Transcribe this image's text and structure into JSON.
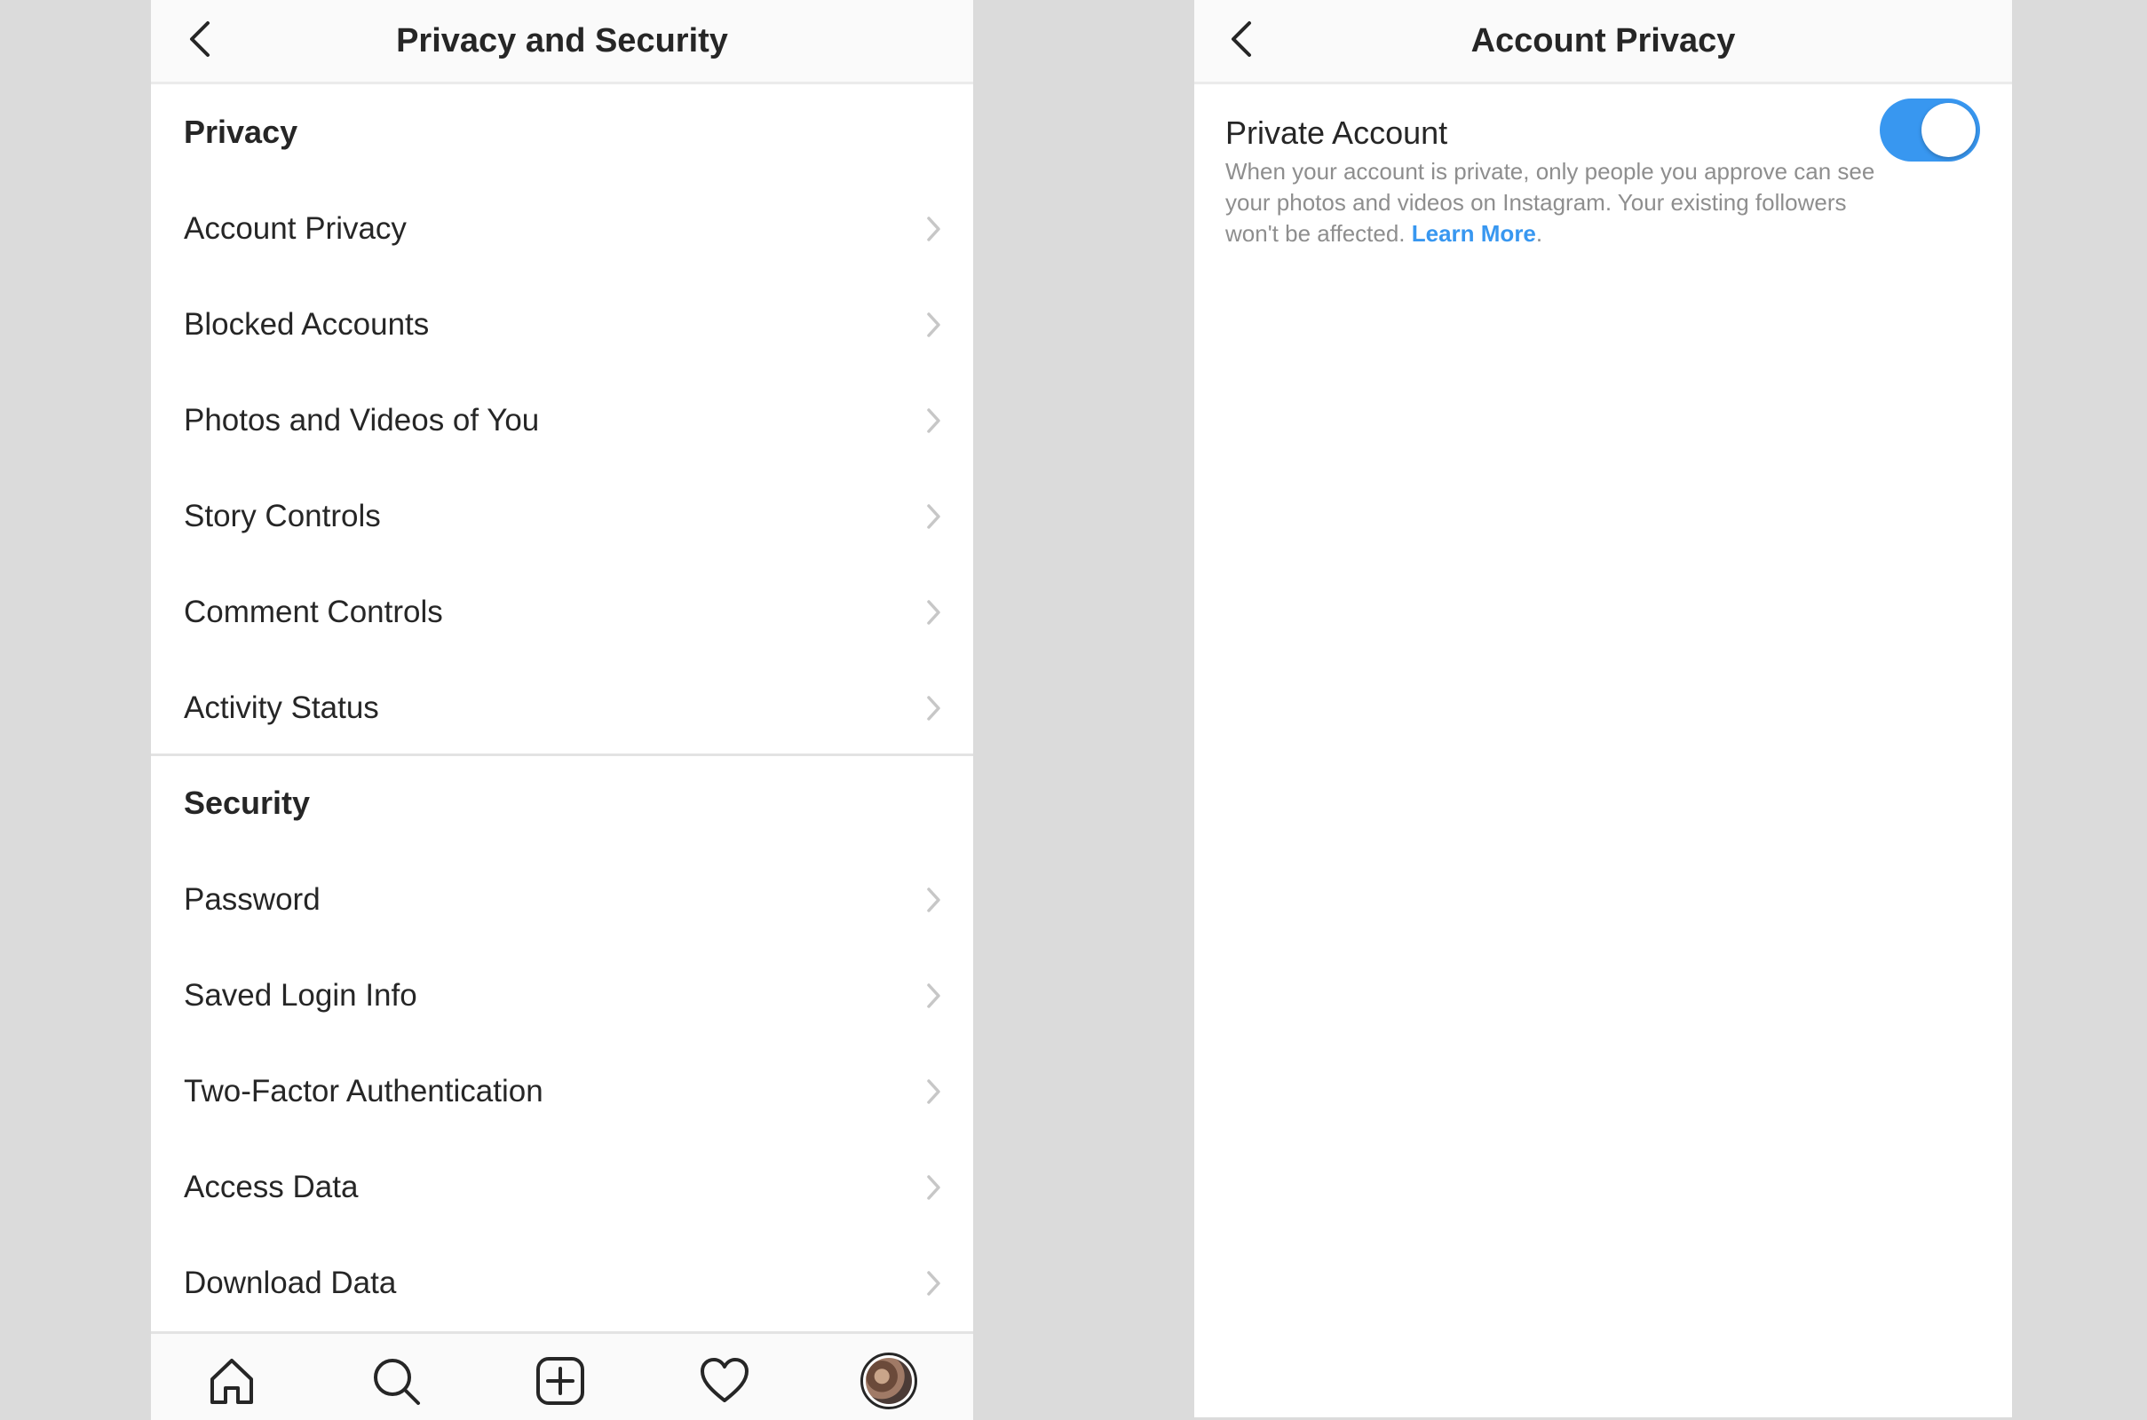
{
  "left": {
    "header": {
      "title": "Privacy and Security"
    },
    "privacy_section": {
      "title": "Privacy",
      "items": [
        {
          "label": "Account Privacy"
        },
        {
          "label": "Blocked Accounts"
        },
        {
          "label": "Photos and Videos of You"
        },
        {
          "label": "Story Controls"
        },
        {
          "label": "Comment Controls"
        },
        {
          "label": "Activity Status"
        }
      ]
    },
    "security_section": {
      "title": "Security",
      "items": [
        {
          "label": "Password"
        },
        {
          "label": "Saved Login Info"
        },
        {
          "label": "Two-Factor Authentication"
        },
        {
          "label": "Access Data"
        },
        {
          "label": "Download Data"
        }
      ]
    },
    "tab_bar": {
      "icons": [
        "home-icon",
        "search-icon",
        "add-post-icon",
        "heart-icon",
        "profile-avatar"
      ]
    }
  },
  "right": {
    "header": {
      "title": "Account Privacy"
    },
    "setting": {
      "title": "Private Account",
      "description": "When your account is private, only people you approve can see your photos and videos on Instagram. Your existing followers won't be affected.",
      "learn_more": "Learn More",
      "trailing_period": ".",
      "toggle_on": true
    }
  },
  "colors": {
    "background": "#dbdbdb",
    "accent": "#3897f0",
    "text_primary": "#262626",
    "text_secondary": "#8e8e8e"
  }
}
